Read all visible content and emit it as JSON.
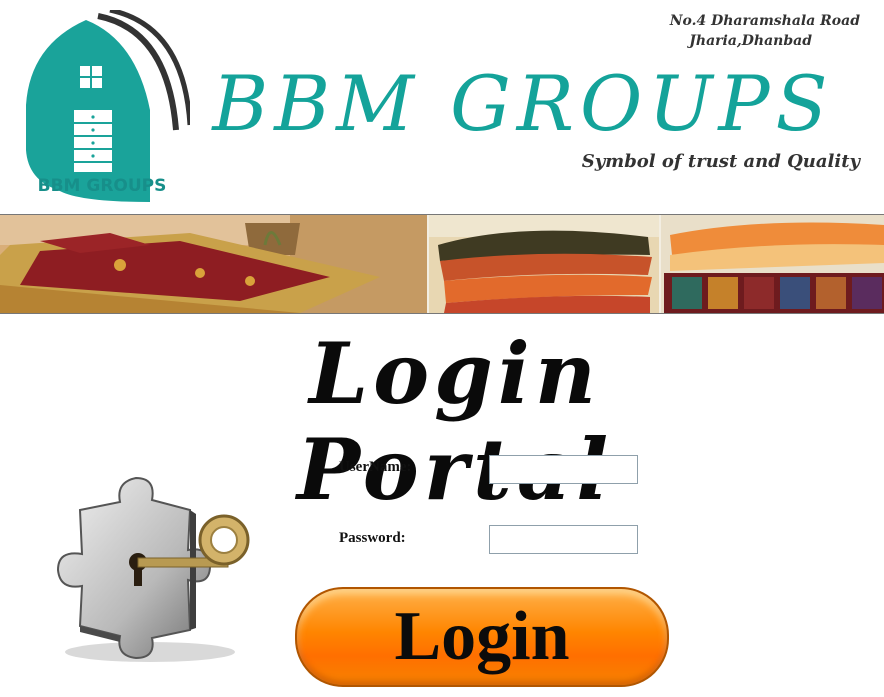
{
  "header": {
    "logo_caption": "BBM GROUPS",
    "brand_title": "BBM GROUPS",
    "address_line1": "No.4 Dharamshala Road",
    "address_line2": "Jharia,Dhanbad",
    "tagline": "Symbol of trust and Quality"
  },
  "banner": {
    "icon": "furnishings-photo-banner"
  },
  "login": {
    "title": "Login Portal",
    "username_label": "UserName:",
    "username_value": "",
    "password_label": "Password:",
    "password_value": "",
    "button_label": "Login",
    "illustration": "puzzle-key-icon"
  },
  "colors": {
    "brand_teal": "#14a39a",
    "button_orange": "#ff8500"
  }
}
